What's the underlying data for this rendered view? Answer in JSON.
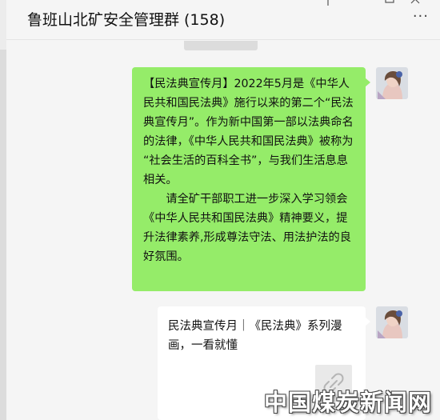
{
  "header": {
    "group_name": "鲁班山北矿安全管理群",
    "member_count": "(158)",
    "more_menu": "···"
  },
  "messages": [
    {
      "sender": "self",
      "type": "text",
      "paragraphs": [
        "【民法典宣传月】2022年5月是《中华人民共和国民法典》施行以来的第二个“民法典宣传月”。作为新中国第一部以法典命名的法律，《中华人民共和国民法典》被称为 “社会生活的百科全书”，与我们生活息息相关。",
        "请全矿干部职工进一步深入学习领会《中华人民共和国民法典》精神要义，提升法律素养,形成尊法守法、用法护法的良好氛围。"
      ]
    },
    {
      "sender": "self",
      "type": "link_card",
      "title": "民法典宣传月｜《民法典》系列漫画，一看就懂"
    }
  ],
  "watermark": "中国煤炭新闻网",
  "colors": {
    "bubble_green": "#95ec69",
    "chat_background": "#f5f5f5",
    "card_background": "#ffffff"
  }
}
